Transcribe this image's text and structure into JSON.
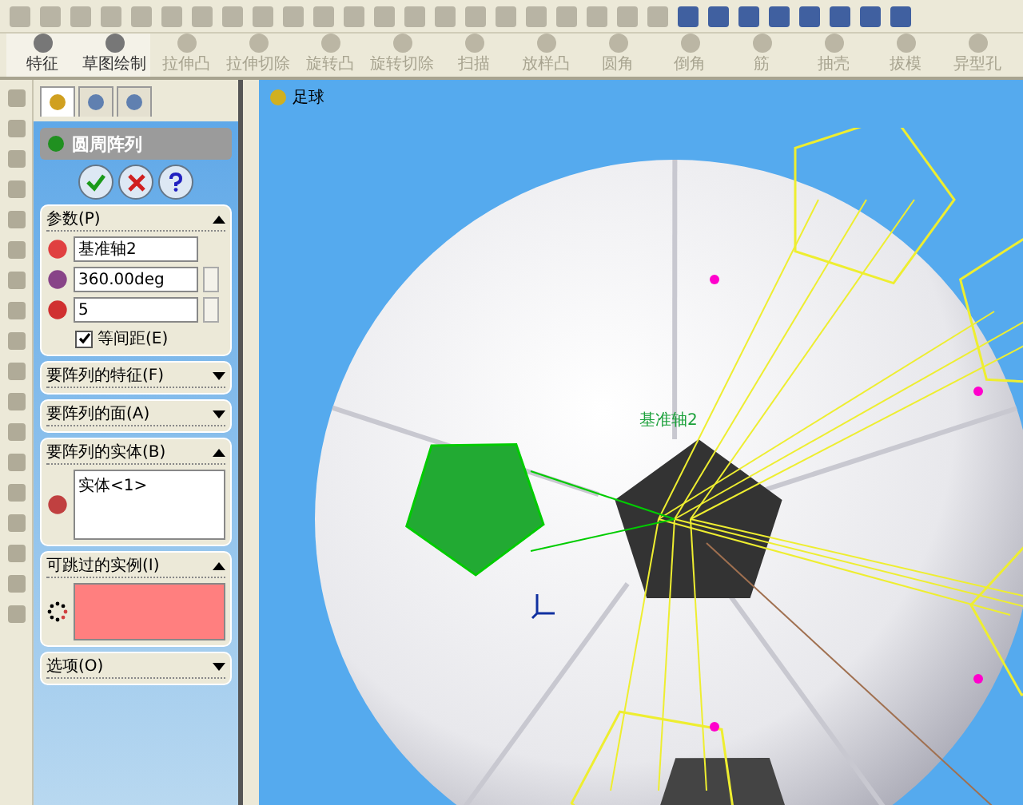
{
  "command_manager": [
    {
      "label": "特征",
      "enabled": true
    },
    {
      "label": "草图绘制",
      "enabled": true
    },
    {
      "label": "拉伸凸",
      "enabled": false
    },
    {
      "label": "拉伸切除",
      "enabled": false
    },
    {
      "label": "旋转凸",
      "enabled": false
    },
    {
      "label": "旋转切除",
      "enabled": false
    },
    {
      "label": "扫描",
      "enabled": false
    },
    {
      "label": "放样凸",
      "enabled": false
    },
    {
      "label": "圆角",
      "enabled": false
    },
    {
      "label": "倒角",
      "enabled": false
    },
    {
      "label": "筋",
      "enabled": false
    },
    {
      "label": "抽壳",
      "enabled": false
    },
    {
      "label": "拔模",
      "enabled": false
    },
    {
      "label": "异型孔",
      "enabled": false
    }
  ],
  "property_manager": {
    "tabs": [
      {
        "selected": true
      },
      {
        "selected": false
      },
      {
        "selected": false
      }
    ],
    "title": "圆周阵列",
    "sections": [
      {
        "kind": "params",
        "title": "参数(P)",
        "expanded": true,
        "axis": "基准轴2",
        "angle": "360.00deg",
        "count": "5",
        "equal_spacing": {
          "label": "等间距(E)",
          "checked": true
        }
      },
      {
        "title": "要阵列的特征(F)",
        "expanded": false
      },
      {
        "title": "要阵列的面(A)",
        "expanded": false
      },
      {
        "kind": "list",
        "title": "要阵列的实体(B)",
        "expanded": true,
        "items": [
          "实体<1>"
        ]
      },
      {
        "kind": "skip",
        "title": "可跳过的实例(I)",
        "expanded": true
      },
      {
        "title": "选项(O)",
        "expanded": false
      }
    ]
  },
  "viewport": {
    "part_name": "足球",
    "axis_label": "基准轴2"
  }
}
